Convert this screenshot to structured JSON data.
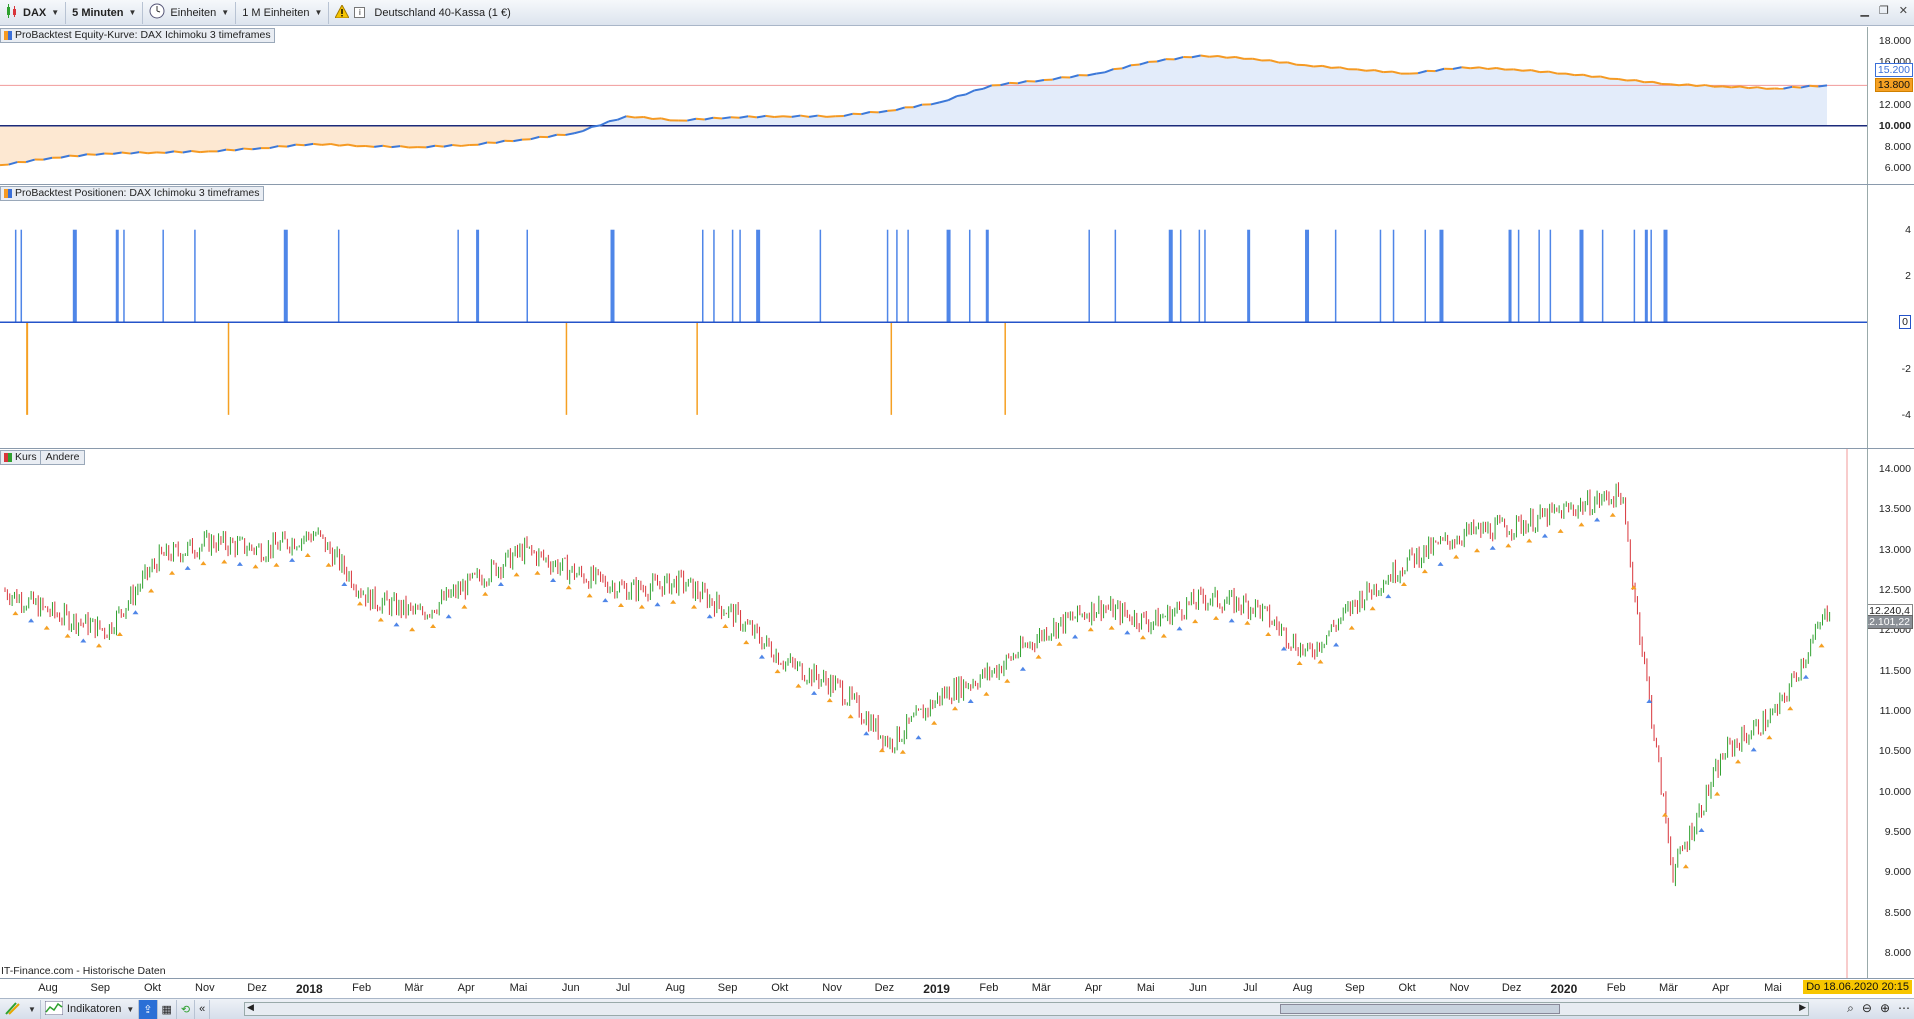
{
  "toolbar": {
    "instrument": "DAX",
    "timeframe": "5 Minuten",
    "units_mode": "Einheiten",
    "units_count": "1 M Einheiten",
    "instrument_name": "Deutschland 40-Kassa (1 €)"
  },
  "equity_panel": {
    "title": "ProBacktest Equity-Kurve: DAX Ichimoku 3 timeframes",
    "axis_ticks": [
      "18.000",
      "16.000",
      "14.000",
      "12.000",
      "10.000",
      "8.000",
      "6.000"
    ],
    "highlight_values": [
      "15.200",
      "13.800"
    ]
  },
  "positions_panel": {
    "title": "ProBacktest Positionen: DAX Ichimoku 3 timeframes",
    "axis_ticks": [
      "4",
      "2",
      "0",
      "-2",
      "-4"
    ]
  },
  "price_panel": {
    "title_kurs": "Kurs",
    "title_andere": "Andere",
    "axis_ticks": [
      "14.000",
      "13.500",
      "13.000",
      "12.500",
      "12.000",
      "11.500",
      "11.000",
      "10.500",
      "10.000",
      "9.500",
      "9.000",
      "8.500",
      "8.000"
    ],
    "last_price": "12.240,4",
    "second_value": "12.101,22",
    "source_note": "IT-Finance.com - Historische Daten"
  },
  "time_axis": {
    "labels": [
      "Aug",
      "Sep",
      "Okt",
      "Nov",
      "Dez",
      "2018",
      "Feb",
      "Mär",
      "Apr",
      "Mai",
      "Jun",
      "Jul",
      "Aug",
      "Sep",
      "Okt",
      "Nov",
      "Dez",
      "2019",
      "Feb",
      "Mär",
      "Apr",
      "Mai",
      "Jun",
      "Jul",
      "Aug",
      "Sep",
      "Okt",
      "Nov",
      "Dez",
      "2020",
      "Feb",
      "Mär",
      "Apr",
      "Mai"
    ],
    "current_date": "Do 18.06.2020 20:15"
  },
  "bottom_bar": {
    "indicators_label": "Indikatoren"
  },
  "colors": {
    "up": "#2fa12f",
    "down": "#d8353b",
    "equity_up": "#3c78d8",
    "equity_flat": "#f59a23",
    "equity_fill_pos": "#e3ecfa",
    "equity_fill_neg": "#fde8d2",
    "long": "#4f86e8",
    "short": "#f5a023"
  },
  "chart_data": [
    {
      "type": "area",
      "title": "ProBacktest Equity-Kurve: DAX Ichimoku 3 timeframes",
      "baseline": 10000,
      "ylim": [
        5000,
        19000
      ],
      "x": [
        "2017-07",
        "2017-08",
        "2017-09",
        "2017-10",
        "2017-11",
        "2017-12",
        "2018-01",
        "2018-02",
        "2018-03",
        "2018-04",
        "2018-05",
        "2018-06",
        "2018-07",
        "2018-08",
        "2018-09",
        "2018-10",
        "2018-11",
        "2018-12",
        "2019-01",
        "2019-02",
        "2019-03",
        "2019-04",
        "2019-05",
        "2019-06",
        "2019-07",
        "2019-08",
        "2019-09",
        "2019-10",
        "2019-11",
        "2019-12",
        "2020-01",
        "2020-02",
        "2020-03",
        "2020-04",
        "2020-05",
        "2020-06"
      ],
      "values": [
        6300,
        7000,
        7400,
        7500,
        7600,
        7900,
        8300,
        8100,
        8000,
        8200,
        8700,
        9300,
        10900,
        10500,
        10800,
        10900,
        10900,
        11400,
        12200,
        13800,
        14300,
        14900,
        16000,
        16600,
        16300,
        15700,
        15300,
        14900,
        15500,
        15300,
        14900,
        14400,
        13900,
        13700,
        13500,
        13800
      ]
    },
    {
      "type": "bar",
      "title": "ProBacktest Positionen: DAX Ichimoku 3 timeframes",
      "ylim": [
        -5,
        5.5
      ],
      "long_positions_pct": [
        0.8,
        1.1,
        3.9,
        6.2,
        6.6,
        8.7,
        10.4,
        15.2,
        18.1,
        24.5,
        25.5,
        28.2,
        32.7,
        37.6,
        38.2,
        39.2,
        39.6,
        40.5,
        43.9,
        47.5,
        48.0,
        48.6,
        50.7,
        51.9,
        52.8,
        58.3,
        59.7,
        62.6,
        63.2,
        64.2,
        64.5,
        66.8,
        69.9,
        71.5,
        73.9,
        74.6,
        76.3,
        77.1,
        80.8,
        81.3,
        82.4,
        83.0,
        84.6,
        85.8,
        87.5,
        88.1,
        88.4,
        89.1
      ],
      "long_values": [
        4,
        4,
        4,
        4,
        4,
        4,
        4,
        4,
        4,
        4,
        4,
        4,
        4,
        4,
        4,
        4,
        4,
        4,
        4,
        4,
        4,
        4,
        4,
        4,
        4,
        4,
        4,
        4,
        4,
        4,
        4,
        4,
        4,
        4,
        4,
        4,
        4,
        4,
        4,
        4,
        4,
        4,
        4,
        4,
        4,
        4,
        4,
        4
      ],
      "short_positions_pct": [
        1.4,
        12.2,
        30.3,
        37.3,
        47.7,
        53.8
      ],
      "short_values": [
        -4,
        -4,
        -4,
        -4,
        -4,
        -4
      ]
    },
    {
      "type": "line",
      "title": "Kurs",
      "ylim": [
        7800,
        14250
      ],
      "x": [
        "2017-07",
        "2017-08",
        "2017-09",
        "2017-10",
        "2017-11",
        "2017-12",
        "2018-01",
        "2018-02",
        "2018-03",
        "2018-04",
        "2018-05",
        "2018-06",
        "2018-07",
        "2018-08",
        "2018-09",
        "2018-10",
        "2018-11",
        "2018-12",
        "2019-01",
        "2019-02",
        "2019-03",
        "2019-04",
        "2019-05",
        "2019-06",
        "2019-07",
        "2019-08",
        "2019-09",
        "2019-10",
        "2019-11",
        "2019-12",
        "2020-01",
        "2020-02",
        "2020-03",
        "2020-04",
        "2020-05",
        "2020-06"
      ],
      "values": [
        12500,
        12200,
        12000,
        12900,
        13100,
        13000,
        13200,
        12400,
        12200,
        12600,
        13000,
        12700,
        12500,
        12600,
        12200,
        11600,
        11300,
        10600,
        11200,
        11500,
        12000,
        12300,
        12100,
        12400,
        12300,
        11700,
        12400,
        12900,
        13200,
        13300,
        13500,
        13700,
        9000,
        10500,
        11000,
        12300
      ]
    }
  ]
}
